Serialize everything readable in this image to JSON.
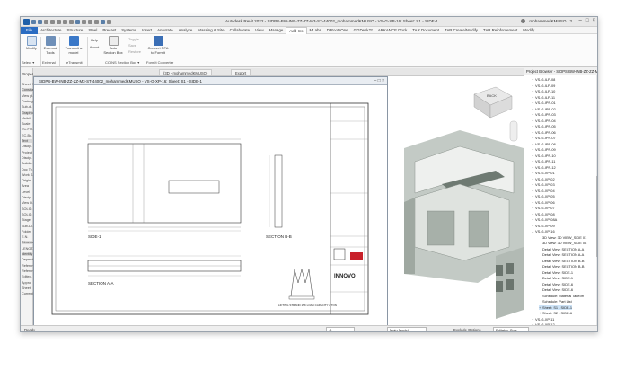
{
  "window": {
    "title": "Autodesk Revit 2022 - SIDPS-BW-INB-ZZ-ZZ-M3-ST-44002_mohammedKMUSO - VS-G-XP-16: Sheet: S1 - SIDE-1",
    "user": "mohammedKMUSO",
    "controls": [
      "–",
      "□",
      "×"
    ]
  },
  "ribbon_tabs": [
    "File",
    "Architecture",
    "Structure",
    "Steel",
    "Precast",
    "Systems",
    "Insert",
    "Annotate",
    "Analyze",
    "Massing & Site",
    "Collaborate",
    "View",
    "Manage",
    "Add-Ins",
    "MLabs",
    "DiRootsOne",
    "GGDesk™",
    "ARKANCE Dock",
    "TAR Document",
    "TAR Create/Modify",
    "TAR Reinforcement",
    "Modify"
  ],
  "active_tab": "Add-Ins",
  "ribbon": {
    "modify": "Modify",
    "external_tools": "External Tools",
    "transmit_model": "Transmit a model",
    "help": "Help",
    "about": "About",
    "auto_section_box": "Auto Section Box",
    "toggle": "Toggle",
    "save": "Save",
    "restore": "Restore",
    "convert_rfa": "Convert RFA to Formit",
    "groups": {
      "select": "Select ▾",
      "external": "External",
      "etransmit": "eTransmit",
      "coins": "COINS Section Box ▾",
      "formit": "FormIt Converter"
    }
  },
  "properties": {
    "title": "Properties",
    "items": [
      "Sheet: S1",
      "Constraints",
      "View pl.",
      "Packag.",
      "Sub-di.",
      "Graphics",
      "Visibili.",
      "Scale",
      "EC-Fin.",
      "EC-Bu.",
      "Text",
      "Discipl.",
      "Project",
      "Discipl.",
      "Buildin.",
      "Doc Ty.",
      "Work S.",
      "Origin.",
      "Area",
      "Level",
      "Discipl.",
      "View D.",
      "SOLID.",
      "SOLID.",
      "Stage",
      "Sub-Di.",
      "Folder",
      "E.N.",
      "Dimensi.",
      "LENGT.",
      "Identity",
      "Depend.",
      "Referen.",
      "Referen.",
      "Edited.",
      "Appro.",
      "Sheet.",
      "Current"
    ]
  },
  "view_tabs": [
    "{3D - mohammedKMUSO}",
    "Export"
  ],
  "sheet_window": {
    "title": "SIDPS-BW-INB-ZZ-ZZ-M3-ST-44002_mohammedKMUSO - VS-G-XP-16: Sheet: S1 - SIDE-1",
    "labels": {
      "side1": "SIDE-1",
      "section_aa": "SECTION A-A",
      "section_bb": "SECTION B-B",
      "lifting_strand": "LIFTING STRAND 15K LOAD CAPACITY 2 TON",
      "company": "INNOVO"
    }
  },
  "view3d": {
    "viewcube_label": "BACK"
  },
  "project_browser": {
    "title": "Project Browser - SIDPS-BW-INB-ZZ-ZZ-M3-ST-4...",
    "rows": [
      {
        "text": "VS-G-ILP-08",
        "indent": 1,
        "exp": "+"
      },
      {
        "text": "VS-G-ILP-09",
        "indent": 1,
        "exp": "+"
      },
      {
        "text": "VS-G-ILP-10",
        "indent": 1,
        "exp": "+"
      },
      {
        "text": "VS-G-ILP-11",
        "indent": 1,
        "exp": "+"
      },
      {
        "text": "VS-G-IPP-01",
        "indent": 1,
        "exp": "+"
      },
      {
        "text": "VS-G-IPP-02",
        "indent": 1,
        "exp": "+"
      },
      {
        "text": "VS-G-IPP-03",
        "indent": 1,
        "exp": "+"
      },
      {
        "text": "VS-G-IPP-04",
        "indent": 1,
        "exp": "+"
      },
      {
        "text": "VS-G-IPP-05",
        "indent": 1,
        "exp": "+"
      },
      {
        "text": "VS-G-IPP-06",
        "indent": 1,
        "exp": "+"
      },
      {
        "text": "VS-G-IPP-07",
        "indent": 1,
        "exp": "+"
      },
      {
        "text": "VS-G-IPP-08",
        "indent": 1,
        "exp": "+"
      },
      {
        "text": "VS-G-IPP-09",
        "indent": 1,
        "exp": "+"
      },
      {
        "text": "VS-G-IPP-10",
        "indent": 1,
        "exp": "+"
      },
      {
        "text": "VS-G-IPP-11",
        "indent": 1,
        "exp": "+"
      },
      {
        "text": "VS-G-IPP-12",
        "indent": 1,
        "exp": "+"
      },
      {
        "text": "VS-G-XP-01",
        "indent": 1,
        "exp": "+"
      },
      {
        "text": "VS-G-XP-02",
        "indent": 1,
        "exp": "+"
      },
      {
        "text": "VS-G-XP-03",
        "indent": 1,
        "exp": "+"
      },
      {
        "text": "VS-G-XP-04",
        "indent": 1,
        "exp": "+"
      },
      {
        "text": "VS-G-XP-05",
        "indent": 1,
        "exp": "+"
      },
      {
        "text": "VS-G-XP-06",
        "indent": 1,
        "exp": "+"
      },
      {
        "text": "VS-G-XP-07",
        "indent": 1,
        "exp": "+"
      },
      {
        "text": "VS-G-XP-08",
        "indent": 1,
        "exp": "+"
      },
      {
        "text": "VS-G-XP-08A",
        "indent": 1,
        "exp": "+"
      },
      {
        "text": "VS-G-XP-09",
        "indent": 1,
        "exp": "+"
      },
      {
        "text": "VS-G-XP-16",
        "indent": 1,
        "exp": "–"
      },
      {
        "text": "3D View: 3D VIEW_SIDE 01",
        "indent": 2,
        "exp": ""
      },
      {
        "text": "3D View: 3D VIEW_SIDE 08",
        "indent": 2,
        "exp": ""
      },
      {
        "text": "Detail View: SECTION A-A",
        "indent": 2,
        "exp": ""
      },
      {
        "text": "Detail View: SECTION A-A",
        "indent": 2,
        "exp": ""
      },
      {
        "text": "Detail View: SECTION B-B",
        "indent": 2,
        "exp": ""
      },
      {
        "text": "Detail View: SECTION B-B",
        "indent": 2,
        "exp": ""
      },
      {
        "text": "Detail View: SIDE-1",
        "indent": 2,
        "exp": ""
      },
      {
        "text": "Detail View: SIDE-1",
        "indent": 2,
        "exp": ""
      },
      {
        "text": "Detail View: SIDE-6",
        "indent": 2,
        "exp": ""
      },
      {
        "text": "Detail View: SIDE-6",
        "indent": 2,
        "exp": ""
      },
      {
        "text": "Schedule: Material Takeoff",
        "indent": 2,
        "exp": ""
      },
      {
        "text": "Schedule: Part List",
        "indent": 2,
        "exp": ""
      },
      {
        "text": "Sheet: S1 - SIDE-1",
        "indent": 2,
        "exp": "+",
        "selected": true
      },
      {
        "text": "Sheet: S2 - SIDE-6",
        "indent": 2,
        "exp": "+"
      },
      {
        "text": "VS-G-XP-11",
        "indent": 1,
        "exp": "+"
      },
      {
        "text": "VS-G-XP-12",
        "indent": 1,
        "exp": "+"
      }
    ]
  },
  "status": {
    "left": "Ready",
    "scale": ":0",
    "model": "Main Model",
    "exclude": "Exclude Options",
    "editable": "Editable Only"
  },
  "colors": {
    "file_tab": "#2a6cc2",
    "selection": "#cde3f7",
    "concrete": "#c7cfc9"
  }
}
